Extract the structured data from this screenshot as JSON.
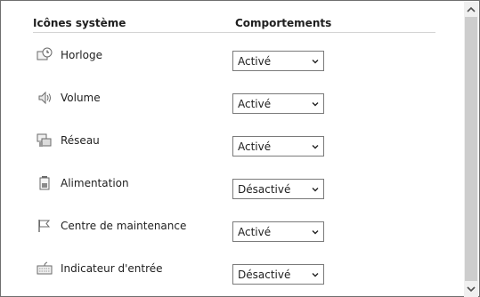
{
  "headers": {
    "icons": "Icônes système",
    "behaviors": "Comportements"
  },
  "rows": [
    {
      "label": "Horloge",
      "value": "Activé",
      "icon": "clock-icon"
    },
    {
      "label": "Volume",
      "value": "Activé",
      "icon": "speaker-icon"
    },
    {
      "label": "Réseau",
      "value": "Activé",
      "icon": "network-icon"
    },
    {
      "label": "Alimentation",
      "value": "Désactivé",
      "icon": "battery-icon"
    },
    {
      "label": "Centre de maintenance",
      "value": "Activé",
      "icon": "flag-icon"
    },
    {
      "label": "Indicateur d'entrée",
      "value": "Désactivé",
      "icon": "keyboard-icon"
    }
  ]
}
